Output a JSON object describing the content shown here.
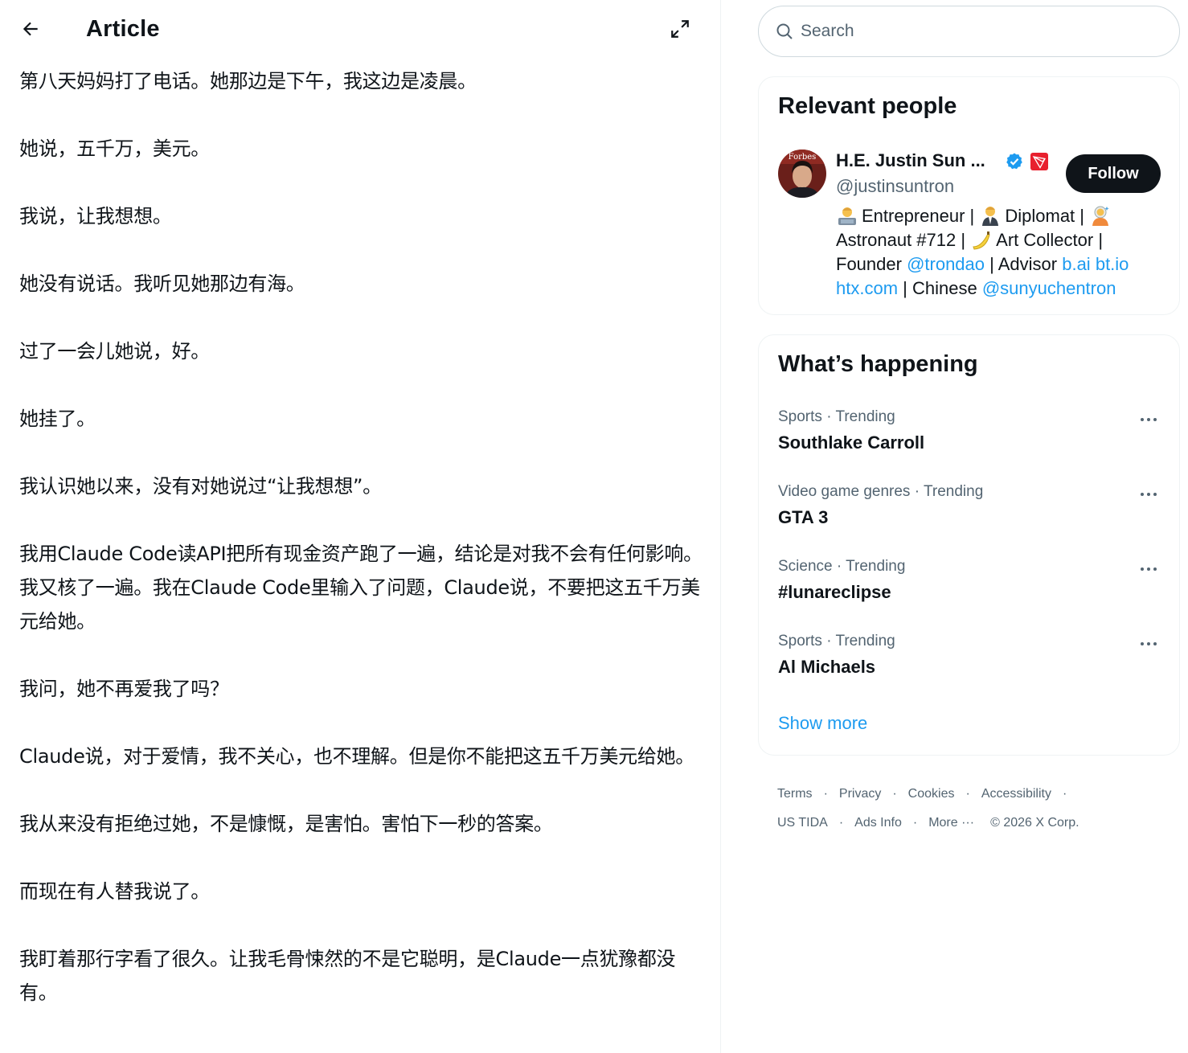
{
  "header": {
    "title": "Article"
  },
  "article": {
    "paragraphs": [
      "第八天妈妈打了电话。她那边是下午，我这边是凌晨。",
      "她说，五千万，美元。",
      "我说，让我想想。",
      "她没有说话。我听见她那边有海。",
      "过了一会儿她说，好。",
      "她挂了。",
      "我认识她以来，没有对她说过“让我想想”。",
      "我用Claude Code读API把所有现金资产跑了一遍，结论是对我不会有任何影响。我又核了一遍。我在Claude Code里输入了问题，Claude说，不要把这五千万美元给她。",
      "我问，她不再爱我了吗？",
      "Claude说，对于爱情，我不关心，也不理解。但是你不能把这五千万美元给她。",
      "我从来没有拒绝过她，不是慷慨，是害怕。害怕下一秒的答案。",
      "而现在有人替我说了。",
      "我盯着那行字看了很久。让我毛骨悚然的不是它聪明，是Claude一点犹豫都没有。"
    ]
  },
  "search": {
    "placeholder": "Search"
  },
  "relevant_people": {
    "title": "Relevant people",
    "avatar_text": "Forbes",
    "person": {
      "name": "H.E. Justin Sun ...",
      "handle": "@justinsuntron",
      "follow_label": "Follow",
      "bio": {
        "t1": "Entrepreneur | ",
        "t2": "Diplomat | ",
        "t3": "Astronaut #712 | ",
        "t4": "Art Collector |",
        "t5": "Founder ",
        "l1": "@trondao",
        "t6": " | Advisor ",
        "l2": "b.ai",
        "t7": " ",
        "l3": "bt.io",
        "l4": "htx.com",
        "t8": " | Chinese ",
        "l5": "@sunyuchentron"
      }
    }
  },
  "trends": {
    "title": "What’s happening",
    "items": [
      {
        "meta": "Sports · Trending",
        "name": "Southlake Carroll"
      },
      {
        "meta": "Video game genres · Trending",
        "name": "GTA 3"
      },
      {
        "meta": "Science · Trending",
        "name": "#lunareclipse"
      },
      {
        "meta": "Sports · Trending",
        "name": "Al Michaels"
      }
    ],
    "show_more": "Show more"
  },
  "footer": {
    "terms": "Terms",
    "privacy": "Privacy",
    "cookies": "Cookies",
    "accessibility": "Accessibility",
    "us_tida": "US TIDA",
    "ads_info": "Ads Info",
    "more": "More ···",
    "copyright": "© 2026 X Corp."
  },
  "colors": {
    "accent": "#1d9bf0",
    "text": "#0f1419",
    "muted": "#536471",
    "border": "#eff3f4",
    "tron_red": "#e8202e"
  }
}
